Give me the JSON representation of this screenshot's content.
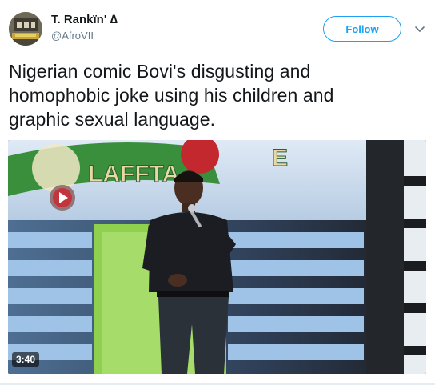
{
  "user": {
    "display_name": "T. Rankïn' ∆",
    "handle": "@AfroVII"
  },
  "actions": {
    "follow_label": "Follow"
  },
  "tweet": {
    "text_line1": "Nigerian comic Bovi's disgusting and",
    "text_line2": "homophobic joke using his children and",
    "text_line3": "graphic sexual language."
  },
  "media": {
    "type": "video",
    "duration": "3:40",
    "banner_letters": "LAFFTA",
    "banner_letters_end": "E"
  },
  "colors": {
    "accent": "#1da1f2",
    "text": "#14171a",
    "secondary": "#657786",
    "banner_green": "#3a8f3c",
    "banner_red": "#c2282e"
  }
}
